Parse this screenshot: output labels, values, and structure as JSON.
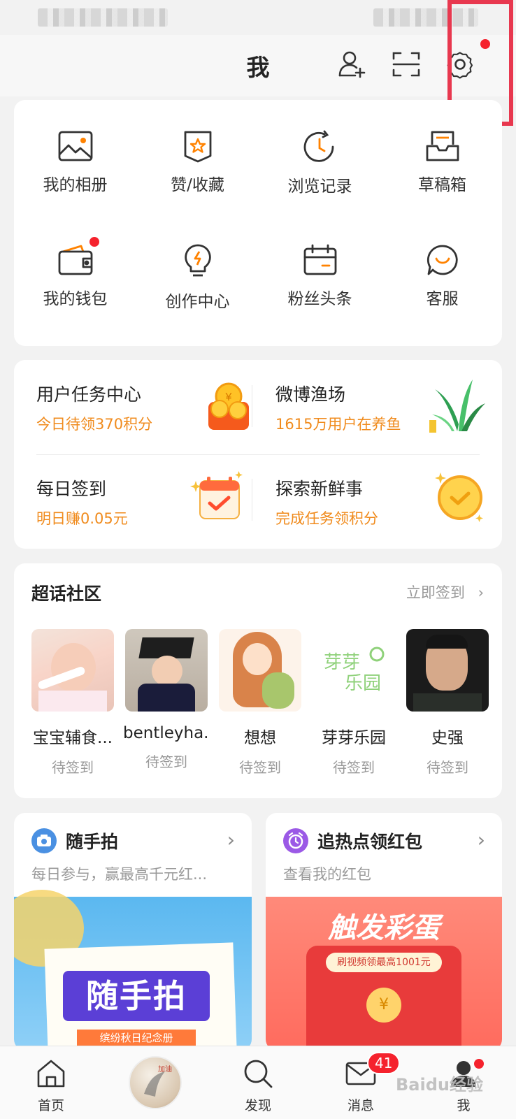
{
  "header": {
    "title": "我"
  },
  "grid": [
    {
      "label": "我的相册"
    },
    {
      "label": "赞/收藏"
    },
    {
      "label": "浏览记录"
    },
    {
      "label": "草稿箱"
    },
    {
      "label": "我的钱包"
    },
    {
      "label": "创作中心"
    },
    {
      "label": "粉丝头条"
    },
    {
      "label": "客服"
    }
  ],
  "tasks": [
    {
      "title": "用户任务中心",
      "sub": "今日待领370积分"
    },
    {
      "title": "微博渔场",
      "sub": "1615万用户在养鱼"
    },
    {
      "title": "每日签到",
      "sub": "明日赚0.05元"
    },
    {
      "title": "探索新鲜事",
      "sub": "完成任务领积分"
    }
  ],
  "supertopic": {
    "title": "超话社区",
    "link": "立即签到",
    "items": [
      {
        "name": "宝宝辅食...",
        "status": "待签到"
      },
      {
        "name": "bentleyha...",
        "status": "待签到"
      },
      {
        "name": "想想",
        "status": "待签到"
      },
      {
        "name": "芽芽乐园",
        "status": "待签到"
      },
      {
        "name": "史强",
        "status": "待签到"
      }
    ]
  },
  "promo": [
    {
      "title": "随手拍",
      "sub": "每日参与，赢最高千元红...",
      "banner_text": "随手拍",
      "banner_sub": "缤纷秋日纪念册"
    },
    {
      "title": "追热点领红包",
      "sub": "查看我的红包",
      "banner_text": "触发彩蛋",
      "banner_sub": "刷视频领最高1001元"
    }
  ],
  "tabbar": {
    "items": [
      {
        "label": "首页"
      },
      {
        "label": "发现"
      },
      {
        "label": "消息"
      },
      {
        "label": "我"
      }
    ],
    "message_badge": "41"
  },
  "watermark": "Baidu经验",
  "colors": {
    "accent": "#ff8200",
    "red_dot": "#f5222d",
    "highlight_box": "#e8384f"
  }
}
